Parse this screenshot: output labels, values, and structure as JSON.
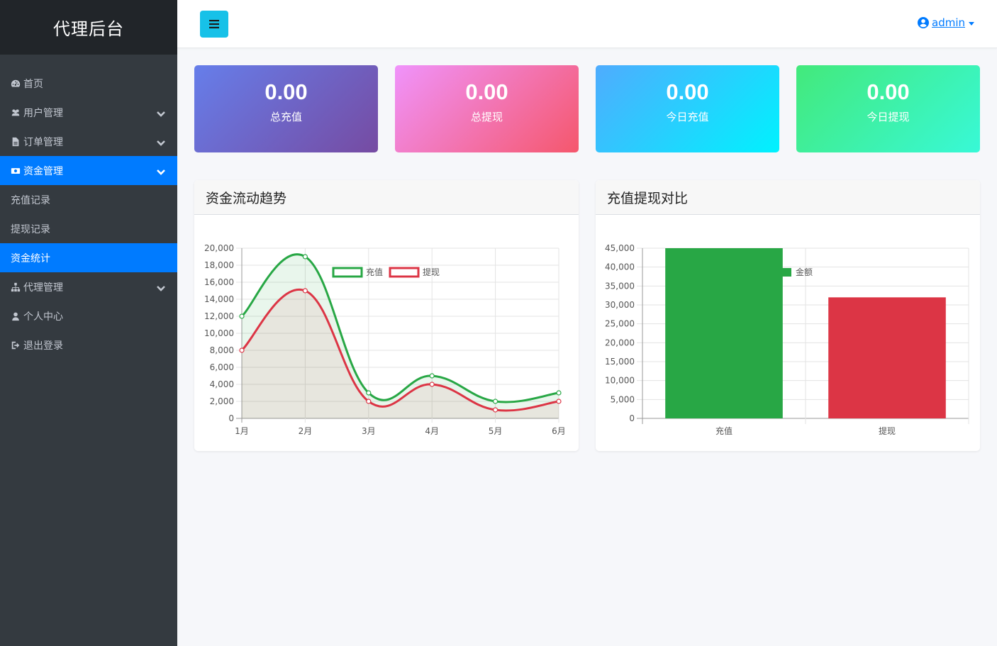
{
  "brand": "代理后台",
  "sidebar": {
    "items": [
      {
        "label": "首页",
        "icon": "dashboard-icon"
      },
      {
        "label": "用户管理",
        "icon": "users-icon"
      },
      {
        "label": "订单管理",
        "icon": "file-icon"
      },
      {
        "label": "资金管理",
        "icon": "money-icon"
      },
      {
        "label": "充值记录"
      },
      {
        "label": "提现记录"
      },
      {
        "label": "资金统计"
      },
      {
        "label": "代理管理",
        "icon": "sitemap-icon"
      },
      {
        "label": "个人中心",
        "icon": "user-icon"
      },
      {
        "label": "退出登录",
        "icon": "sign-out-icon"
      }
    ]
  },
  "topbar": {
    "username": "admin"
  },
  "stats": [
    {
      "value": "0.00",
      "label": "总充值"
    },
    {
      "value": "0.00",
      "label": "总提现"
    },
    {
      "value": "0.00",
      "label": "今日充值"
    },
    {
      "value": "0.00",
      "label": "今日提现"
    }
  ],
  "charts": {
    "trend_title": "资金流动趋势",
    "compare_title": "充值提现对比"
  },
  "chart_data": [
    {
      "type": "line",
      "categories": [
        "1月",
        "2月",
        "3月",
        "4月",
        "5月",
        "6月"
      ],
      "series": [
        {
          "name": "充值",
          "values": [
            12000,
            19000,
            3000,
            5000,
            2000,
            3000
          ],
          "color": "#28a745"
        },
        {
          "name": "提现",
          "values": [
            8000,
            15000,
            2000,
            4000,
            1000,
            2000
          ],
          "color": "#dc3545"
        }
      ],
      "ylim": [
        0,
        20000
      ],
      "ytick_step": 2000,
      "grid": true,
      "legend": "top"
    },
    {
      "type": "bar",
      "categories": [
        "充值",
        "提现"
      ],
      "series": [
        {
          "name": "金额",
          "values": [
            45000,
            32000
          ],
          "colors": [
            "#28a745",
            "#dc3545"
          ]
        }
      ],
      "ylim": [
        0,
        45000
      ],
      "ytick_step": 5000,
      "grid": true,
      "legend": "top"
    }
  ]
}
